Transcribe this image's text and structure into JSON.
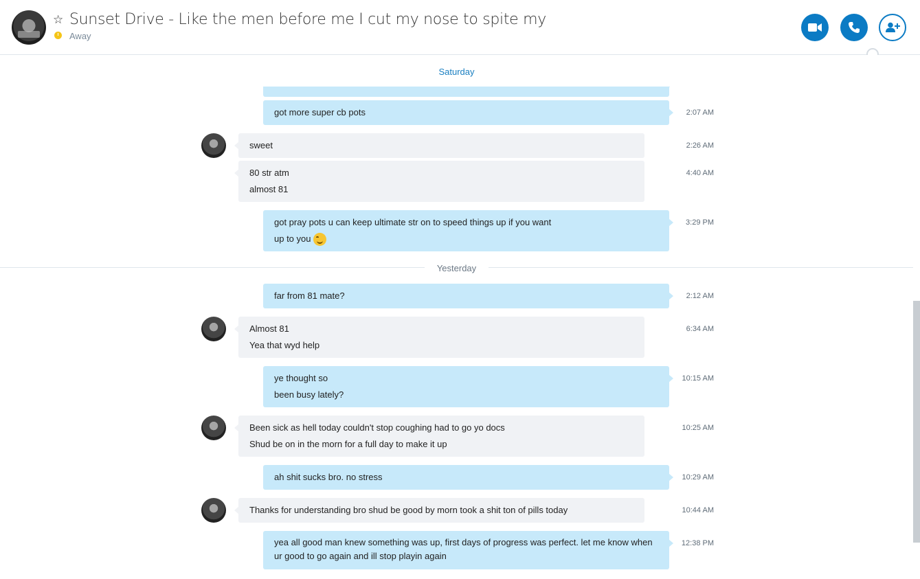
{
  "header": {
    "title": "Sunset Drive - Like the men before me I cut my nose to spite my",
    "status": "Away",
    "favorite_icon": "star-icon",
    "status_color": "#f5c518",
    "buttons": [
      {
        "name": "video-call",
        "icon": "video-camera-icon"
      },
      {
        "name": "audio-call",
        "icon": "phone-icon"
      },
      {
        "name": "add-people",
        "icon": "add-person-icon"
      }
    ],
    "accent": "#0b7bc4"
  },
  "conversation": {
    "sections": [
      {
        "label": "Saturday"
      },
      {
        "label": "Yesterday"
      }
    ],
    "messages": [
      {
        "dir": "out",
        "lines": [
          "got more super cb pots"
        ],
        "time": "2:07 AM"
      },
      {
        "dir": "in",
        "lines": [
          "sweet"
        ],
        "time": "2:26 AM"
      },
      {
        "dir": "in",
        "lines": [
          "80 str atm",
          "almost 81"
        ],
        "time": "4:40 AM"
      },
      {
        "dir": "out",
        "lines": [
          "got pray pots u can keep ultimate str on to speed things up if you want",
          "up to you"
        ],
        "time": "3:29 PM",
        "emoji": "smiling-face-icon"
      },
      {
        "dir": "out",
        "lines": [
          "far from 81 mate?"
        ],
        "time": "2:12 AM"
      },
      {
        "dir": "in",
        "lines": [
          "Almost 81",
          "Yea that wyd help"
        ],
        "time": "6:34 AM"
      },
      {
        "dir": "out",
        "lines": [
          "ye thought so",
          "been busy lately?"
        ],
        "time": "10:15 AM"
      },
      {
        "dir": "in",
        "lines": [
          "Been sick as hell today couldn't stop coughing had to go yo docs",
          "Shud be on in the morn for a full day to make it up"
        ],
        "time": "10:25 AM"
      },
      {
        "dir": "out",
        "lines": [
          "ah shit sucks bro. no stress"
        ],
        "time": "10:29 AM"
      },
      {
        "dir": "in",
        "lines": [
          "Thanks for understanding bro shud be good by morn took a shit ton of pills today"
        ],
        "time": "10:44 AM"
      },
      {
        "dir": "out",
        "lines": [
          "yea all good man knew something was up, first days of progress was perfect. let me know when ur good to go again and ill stop playin again"
        ],
        "time": "12:38 PM"
      }
    ],
    "colors": {
      "outgoing": "#c7e9fa",
      "incoming": "#f0f2f5",
      "section_saturday": "#1a7fc1",
      "section_yesterday": "#6b7885"
    }
  }
}
